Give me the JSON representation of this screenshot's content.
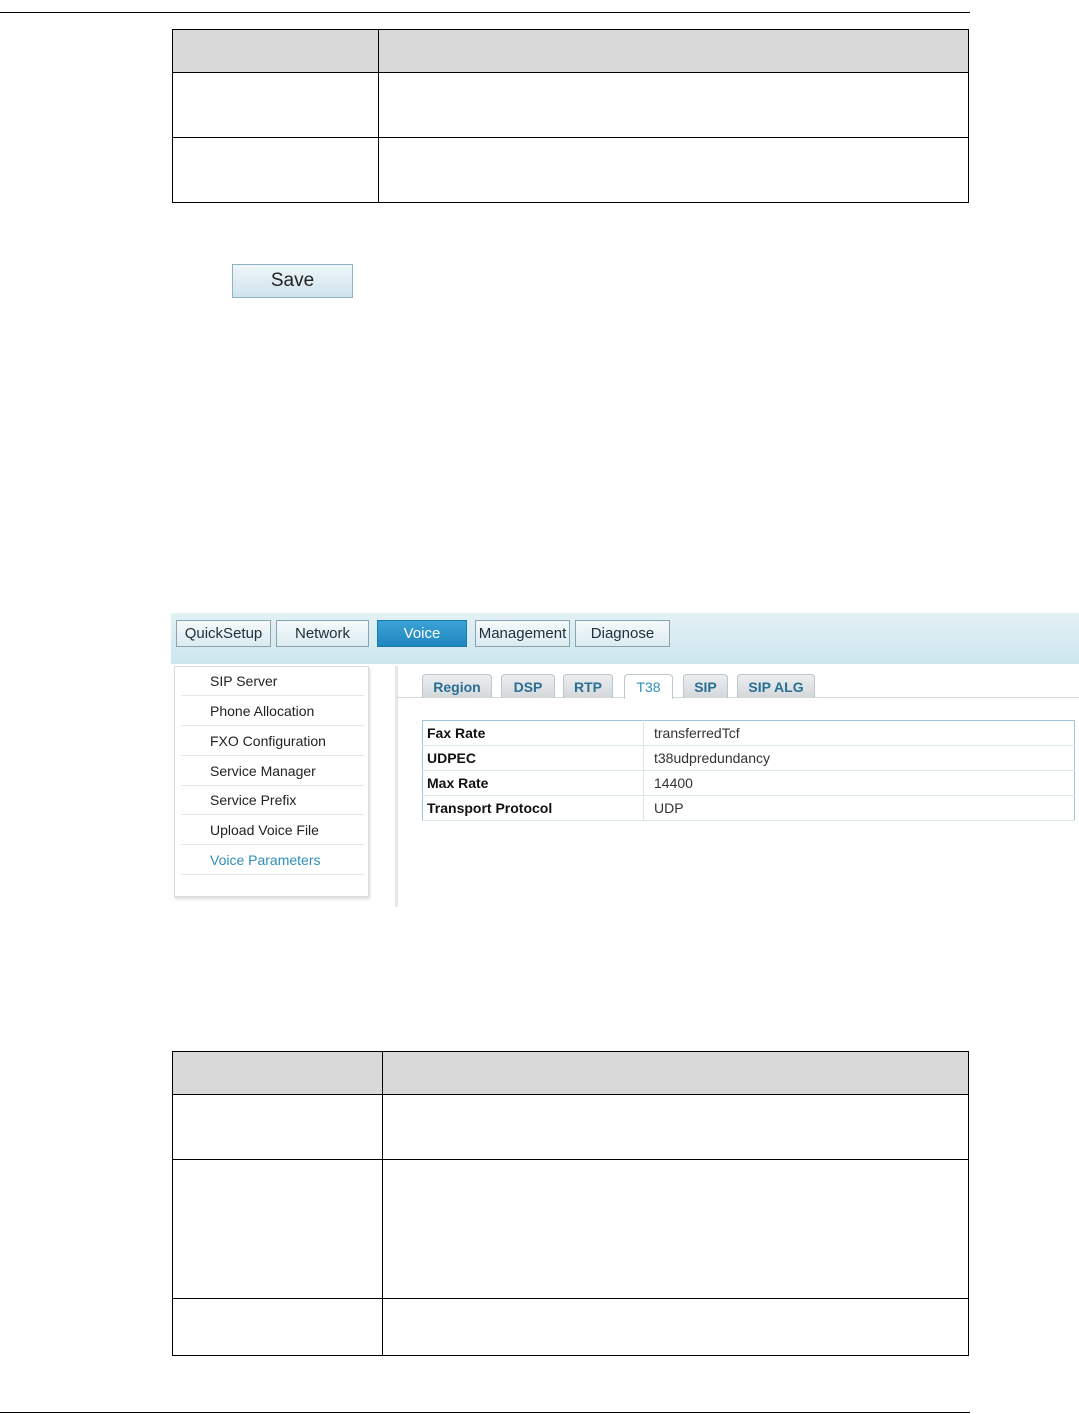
{
  "save_button": {
    "label": "Save"
  },
  "router_ui": {
    "top_nav": [
      {
        "label": "QuickSetup",
        "active": false
      },
      {
        "label": "Network",
        "active": false
      },
      {
        "label": "Voice",
        "active": true
      },
      {
        "label": "Management",
        "active": false
      },
      {
        "label": "Diagnose",
        "active": false
      }
    ],
    "sidebar": [
      {
        "label": "SIP Server",
        "active": false
      },
      {
        "label": "Phone Allocation",
        "active": false
      },
      {
        "label": "FXO Configuration",
        "active": false
      },
      {
        "label": "Service Manager",
        "active": false
      },
      {
        "label": "Service Prefix",
        "active": false
      },
      {
        "label": "Upload Voice File",
        "active": false
      },
      {
        "label": "Voice Parameters",
        "active": true
      }
    ],
    "tabs": [
      {
        "label": "Region",
        "active": false
      },
      {
        "label": "DSP",
        "active": false
      },
      {
        "label": "RTP",
        "active": false
      },
      {
        "label": "T38",
        "active": true
      },
      {
        "label": "SIP",
        "active": false
      },
      {
        "label": "SIP ALG",
        "active": false
      }
    ],
    "t38_params": [
      {
        "key": "Fax Rate",
        "value": "transferredTcf"
      },
      {
        "key": "UDPEC",
        "value": "t38udpredundancy"
      },
      {
        "key": "Max Rate",
        "value": "14400"
      },
      {
        "key": "Transport Protocol",
        "value": "UDP"
      }
    ]
  },
  "colors": {
    "nav_active": "#1f86c0",
    "sidebar_active_text": "#2e8fb8",
    "table_header_fill": "#d9d9d9"
  }
}
